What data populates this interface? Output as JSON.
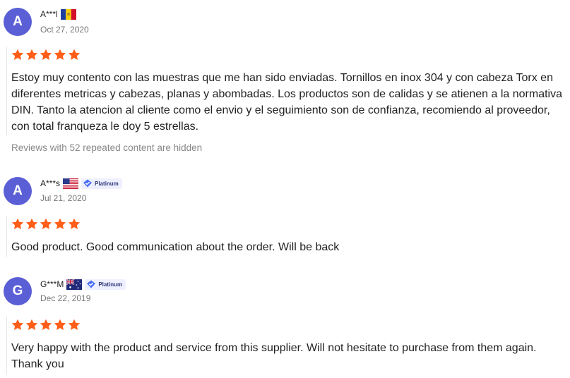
{
  "colors": {
    "avatar": "#5b5fd6",
    "star": "#ff5e18",
    "badge_bg": "#eef0ff",
    "badge_check": "#4a6cf7"
  },
  "reviews": [
    {
      "initial": "A",
      "name": "A***l",
      "flag": "andorra-flag",
      "badge": null,
      "date": "Oct 27, 2020",
      "rating": 5,
      "text": "Estoy muy contento con las muestras que me han sido enviadas. Tornillos en inox 304 y con cabeza Torx en diferentes metricas y cabezas, planas y abombadas. Los productos son de calidas y se atienen a la normativa DIN. Tanto la atencion al cliente como el envio y el seguimiento son de confianza, recomiendo al proveedor, con total franqueza le doy 5 estrellas.",
      "note": "Reviews with 52 repeated content are hidden"
    },
    {
      "initial": "A",
      "name": "A***s",
      "flag": "us-flag",
      "badge": "Platinum",
      "date": "Jul 21, 2020",
      "rating": 5,
      "text": "Good product. Good communication about the order. Will be back"
    },
    {
      "initial": "G",
      "name": "G***M",
      "flag": "australia-flag",
      "badge": "Platinum",
      "date": "Dec 22, 2019",
      "rating": 5,
      "text": "Very happy with the product and service from this supplier. Will not hesitate to purchase from them again. Thank you"
    }
  ]
}
